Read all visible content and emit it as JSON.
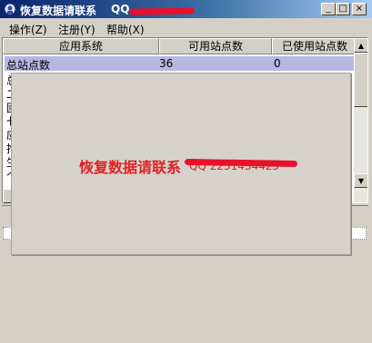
{
  "window": {
    "title": "恢复数据请联系",
    "title_qq": "QQ"
  },
  "title_buttons": {
    "minimize": "_",
    "maximize": "□",
    "close": "×"
  },
  "menu": {
    "items": [
      {
        "label": "操作(Z)"
      },
      {
        "label": "注册(Y)"
      },
      {
        "label": "帮助(X)"
      }
    ]
  },
  "table": {
    "columns": [
      "应用系统",
      "可用站点数",
      "已使用站点数"
    ],
    "rows": [
      {
        "name": "总站点数",
        "available": "36",
        "used": "0"
      }
    ],
    "partial_first_chars": [
      "总",
      "二",
      "國",
      "七",
      "应",
      "抱",
      "生",
      "个"
    ]
  },
  "popup": {
    "title": "恢复数据请联系",
    "qq": "QQ  2251434425"
  },
  "colors": {
    "selected_row": "#b6b8e2",
    "popup_text": "#e02020",
    "redaction": "#e8102a"
  }
}
